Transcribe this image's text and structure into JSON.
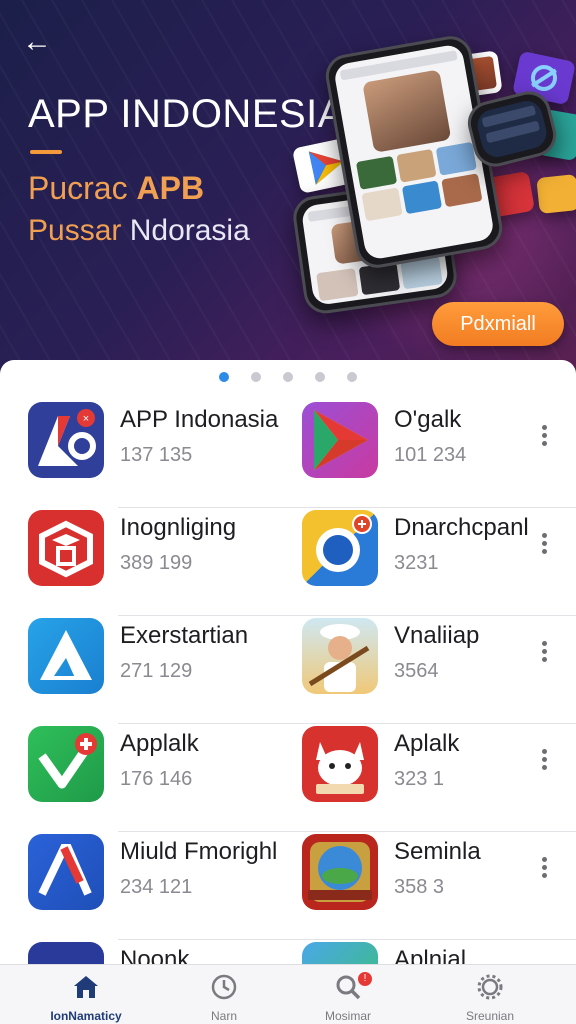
{
  "hero": {
    "title": "APP INDONESIA",
    "line1_normal": "Pucrac ",
    "line1_bold": "APB",
    "line2_orange": "Pussar ",
    "line2_white": "Ndorasia",
    "cta_label": "Pdxmiall",
    "back_icon": "arrow-left-icon",
    "back_glyph": "←"
  },
  "pager": {
    "count": 5,
    "active": 0
  },
  "apps": [
    {
      "left": {
        "name": "APP Indonasia",
        "count": "137 135",
        "icon": "app-indonesia-icon"
      },
      "right": {
        "name": "O'galk",
        "count": "101 234",
        "icon": "play-store-icon"
      }
    },
    {
      "left": {
        "name": "Inognliging",
        "count": "389 199",
        "icon": "cube-icon"
      },
      "right": {
        "name": "Dnarchcpanl",
        "count": "3231",
        "icon": "chrome-ring-icon"
      }
    },
    {
      "left": {
        "name": "Exerstartian",
        "count": "271 129",
        "icon": "triangle-a-icon"
      },
      "right": {
        "name": "Vnaliiap",
        "count": "3564",
        "icon": "character-icon"
      }
    },
    {
      "left": {
        "name": "Applalk",
        "count": "176 146",
        "icon": "checkmark-plus-icon"
      },
      "right": {
        "name": "Aplalk",
        "count": "323 1",
        "icon": "cat-mascot-icon"
      }
    },
    {
      "left": {
        "name": "Miuld Fmorighl",
        "count": "234 121",
        "icon": "lambda-icon"
      },
      "right": {
        "name": "Seminla",
        "count": "358 3",
        "icon": "globe-badge-icon"
      }
    },
    {
      "left": {
        "name": "Noonk",
        "count": "",
        "icon": "blue-app-icon"
      },
      "right": {
        "name": "Aplnial",
        "count": "",
        "icon": "green-app-icon"
      }
    }
  ],
  "nav": [
    {
      "label": "IonNamaticy",
      "icon": "home-icon",
      "active": true
    },
    {
      "label": "Narn",
      "icon": "clock-icon",
      "active": false
    },
    {
      "label": "Mosimar",
      "icon": "search-icon",
      "active": false,
      "badge": "!"
    },
    {
      "label": "Sreunian",
      "icon": "gear-icon",
      "active": false
    }
  ],
  "colors": {
    "accent": "#2d8be8",
    "cta": "#f27c22",
    "hero_bg": "#24204d",
    "nav_active": "#1f3c78"
  }
}
